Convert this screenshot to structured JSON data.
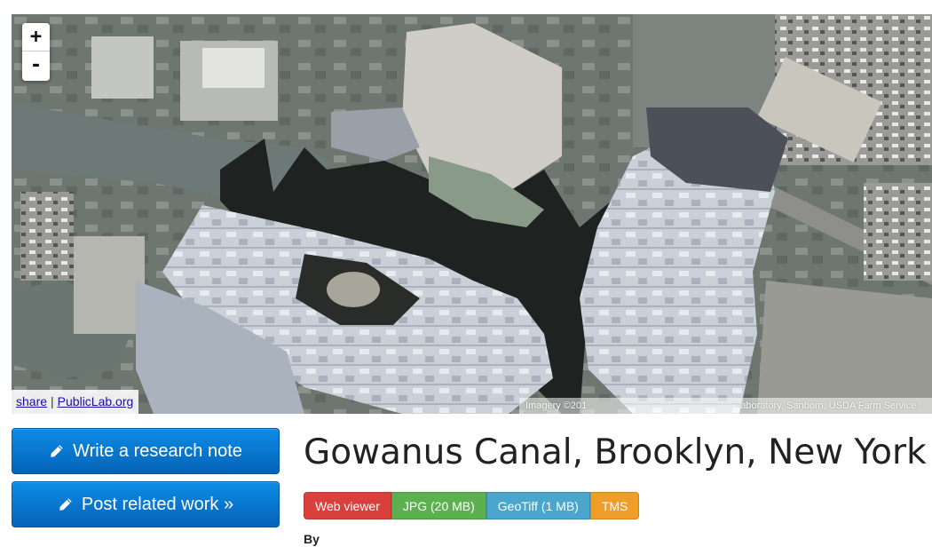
{
  "map": {
    "zoom_in_label": "+",
    "zoom_out_label": "-",
    "share_link": "share",
    "separator": "|",
    "publiclab_link": "PublicLab.org",
    "attribution_left": "Imagery ©201",
    "attribution_right": "aboratory, Sanborn, USDA Farm Service"
  },
  "actions": {
    "write_note": {
      "icon": "pencil-icon",
      "label": "Write a research note"
    },
    "post_work": {
      "icon": "pencil-icon",
      "label": "Post related work »"
    }
  },
  "page": {
    "title": "Gowanus Canal, Brooklyn, New York",
    "by_label": "By"
  },
  "formats": [
    {
      "label": "Web viewer",
      "color": "#d9403c"
    },
    {
      "label": "JPG (20 MB)",
      "color": "#5cb04f"
    },
    {
      "label": "GeoTiff (1 MB)",
      "color": "#4aa6cc"
    },
    {
      "label": "TMS",
      "color": "#f19d2a"
    }
  ]
}
